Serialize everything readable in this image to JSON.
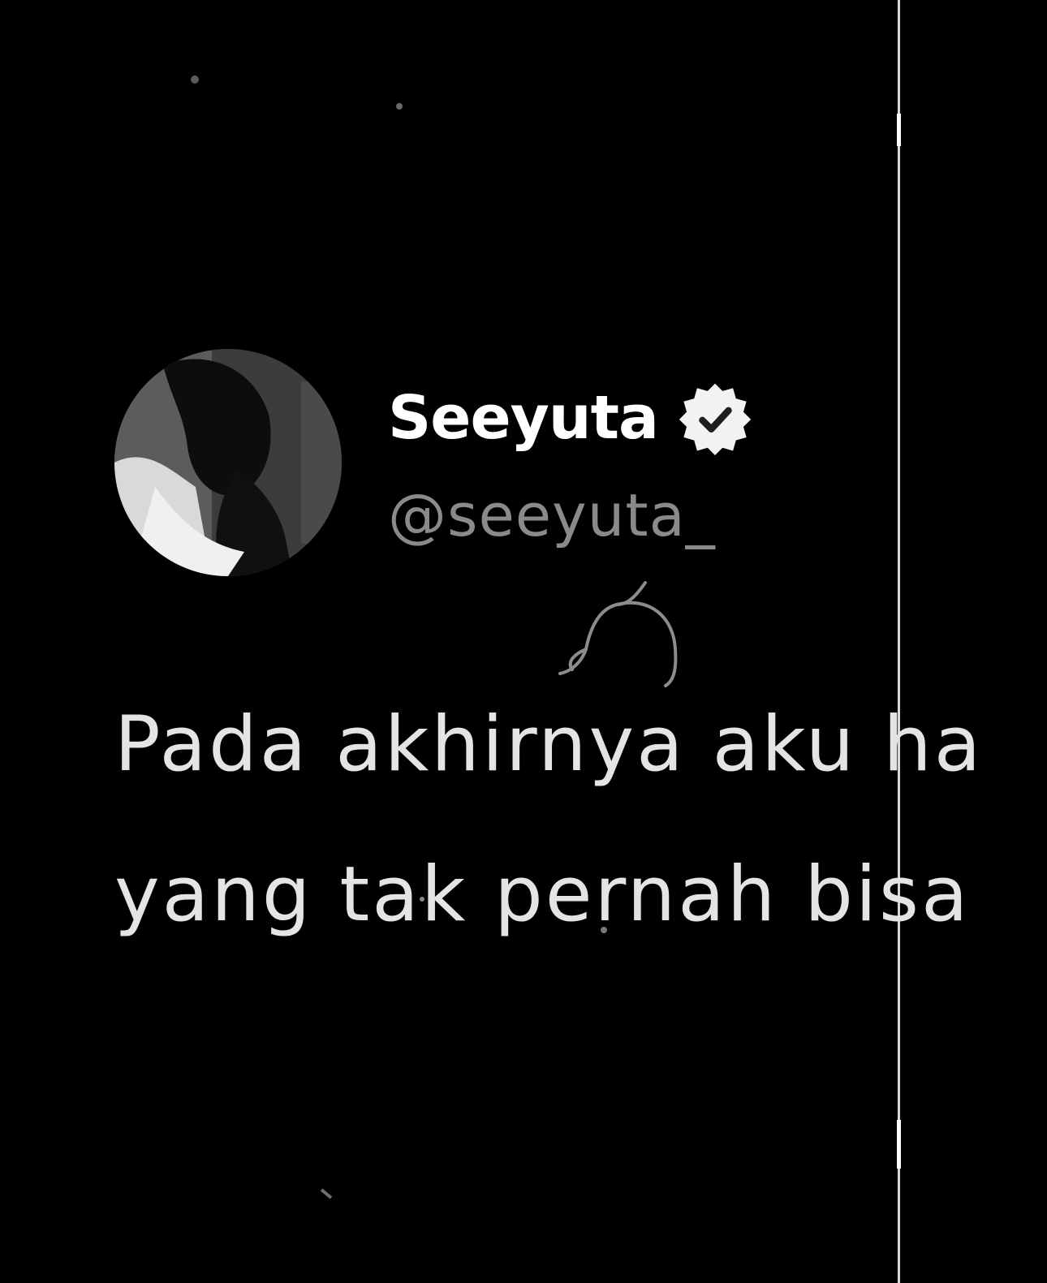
{
  "tweet": {
    "display_name": "Seeyuta",
    "handle": "@seeyuta_",
    "verified_icon": "verified-badge-icon",
    "text_lines": [
      "Pada akhirnya aku ha",
      "yang tak pernah bisa"
    ]
  },
  "colors": {
    "background": "#000000",
    "display_name": "#ffffff",
    "handle": "#8a8a8a",
    "text": "#e4e4e4"
  }
}
